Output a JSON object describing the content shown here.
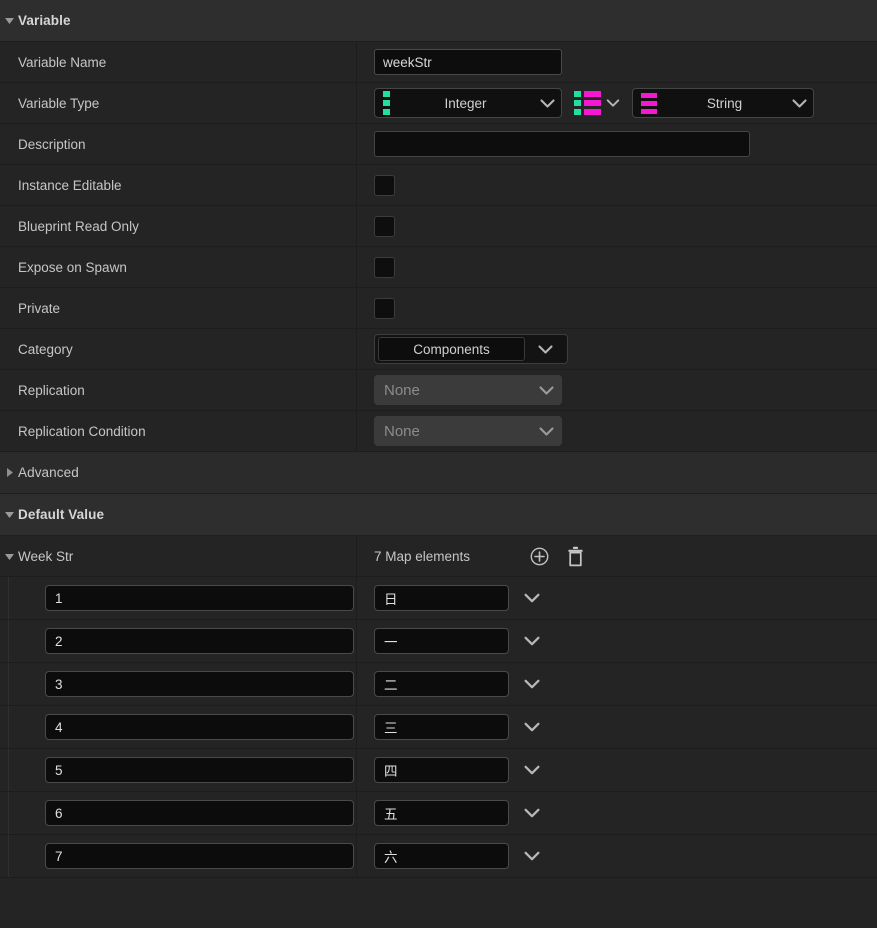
{
  "sections": {
    "variable": {
      "title": "Variable",
      "expanded": true
    },
    "advanced": {
      "title": "Advanced",
      "expanded": false
    },
    "default_value": {
      "title": "Default Value",
      "expanded": true
    }
  },
  "properties": {
    "variable_name": {
      "label": "Variable Name",
      "value": "weekStr"
    },
    "variable_type": {
      "label": "Variable Type",
      "key_type": "Integer",
      "key_icon": "integer-pin-icon",
      "container_type": "Map",
      "container_icon": "map-container-icon",
      "value_type": "String",
      "value_icon": "string-pin-icon"
    },
    "description": {
      "label": "Description",
      "value": "",
      "placeholder": ""
    },
    "instance_editable": {
      "label": "Instance Editable",
      "checked": false
    },
    "blueprint_read_only": {
      "label": "Blueprint Read Only",
      "checked": false
    },
    "expose_on_spawn": {
      "label": "Expose on Spawn",
      "checked": false
    },
    "private": {
      "label": "Private",
      "checked": false
    },
    "category": {
      "label": "Category",
      "value": "Components"
    },
    "replication": {
      "label": "Replication",
      "value": "None",
      "disabled": true
    },
    "replication_condition": {
      "label": "Replication Condition",
      "value": "None",
      "disabled": true
    }
  },
  "default_value": {
    "property_label": "Week Str",
    "elements_count_label": "7 Map elements",
    "add_button_tooltip": "Add Element",
    "clear_button_tooltip": "Remove All Elements",
    "entries": [
      {
        "key": "1",
        "value": "日"
      },
      {
        "key": "2",
        "value": "一"
      },
      {
        "key": "3",
        "value": "二"
      },
      {
        "key": "4",
        "value": "三"
      },
      {
        "key": "5",
        "value": "四"
      },
      {
        "key": "6",
        "value": "五"
      },
      {
        "key": "7",
        "value": "六"
      }
    ]
  },
  "colors": {
    "panel_background": "#242424",
    "section_header_background": "#2e2e2e",
    "integer_pin": "#22dfa0",
    "string_pin": "#f716d2",
    "text_primary": "#c8c8c8",
    "input_background": "#0d0d0d"
  }
}
